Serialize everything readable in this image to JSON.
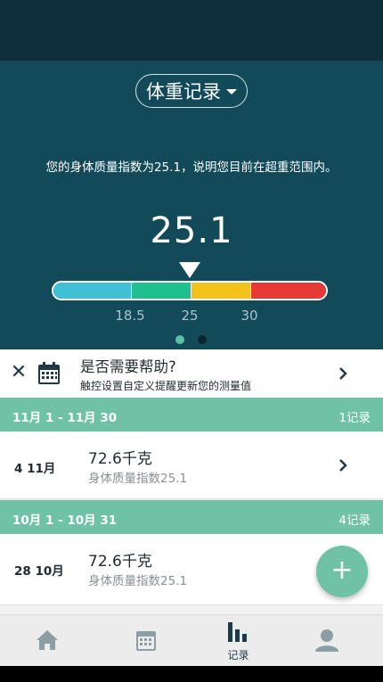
{
  "header": {
    "title": "体重记录",
    "dropdown_icon": "caret-down-icon"
  },
  "bmi": {
    "message": "您的身体质量指数为25.1，说明您目前在超重范围内。",
    "value": "25.1",
    "scale_ticks": [
      "18.5",
      "25",
      "30"
    ],
    "segment_colors": [
      "#40c0d4",
      "#1fbf8f",
      "#f2c21a",
      "#e53935"
    ],
    "pager": {
      "pages": 2,
      "current": 1
    }
  },
  "help_card": {
    "title": "是否需要帮助?",
    "subtitle": "触控设置自定义提醒更新您的测量值",
    "close_icon": "close-icon",
    "calendar_icon": "calendar-icon",
    "arrow_icon": "chevron-right-icon"
  },
  "groups": [
    {
      "range": "11月 1 - 11月 30",
      "count": "1记录",
      "records": [
        {
          "date": "4 11月",
          "weight": "72.6千克",
          "bmi": "身体质量指数25.1"
        }
      ]
    },
    {
      "range": "10月 1 - 10月 31",
      "count": "4记录",
      "records": [
        {
          "date": "28 10月",
          "weight": "72.6千克",
          "bmi": "身体质量指数25.1"
        }
      ]
    }
  ],
  "fab": {
    "label": "+",
    "icon": "plus-icon"
  },
  "bottom_nav": [
    {
      "icon": "home-icon",
      "label": ""
    },
    {
      "icon": "calendar-icon",
      "label": ""
    },
    {
      "icon": "bar-chart-icon",
      "label": "记录"
    },
    {
      "icon": "person-icon",
      "label": ""
    }
  ],
  "colors": {
    "status_bar": "#0d2e3a",
    "hero_bg": "#124a5a",
    "accent": "#6fc2a6",
    "active_dot": "#56c1a6"
  }
}
